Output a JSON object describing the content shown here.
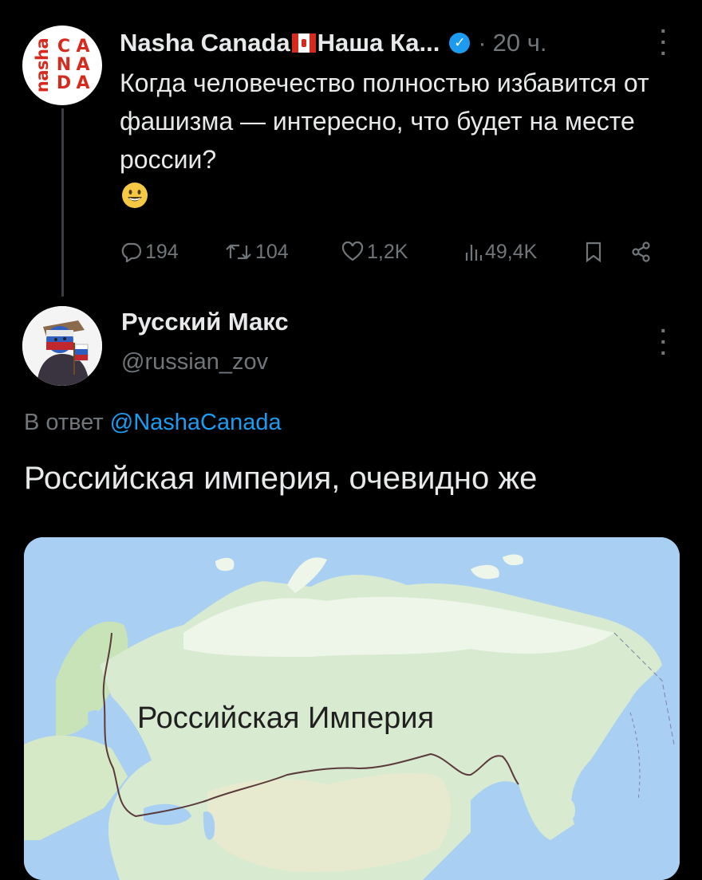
{
  "tweet1": {
    "avatar": {
      "side_text": "nasha",
      "letters": [
        "C",
        "A",
        "N",
        "A",
        "D",
        "A"
      ]
    },
    "author_name": "Nasha Canada",
    "author_name_suffix": "Наша Ка...",
    "verified_icon": "verified-badge-icon",
    "separator": "·",
    "time": "20 ч.",
    "text": "Когда человечество полностью избавится от фашизма — интересно, что будет на месте россии?",
    "emoji": "smiling-face-emoji",
    "stats": {
      "replies": "194",
      "reposts": "104",
      "likes": "1,2K",
      "views": "49,4K"
    }
  },
  "tweet2": {
    "author_name": "Русский Макс",
    "handle": "@russian_zov",
    "reply_prefix": "В ответ",
    "reply_handle": "@NashaCanada",
    "text": "Российская империя, очевидно же",
    "map_label": "Российская Империя"
  },
  "colors": {
    "background": "#000000",
    "text": "#e7e9ea",
    "secondary": "#71767b",
    "link": "#1d9bf0",
    "brand_red": "#d52b1e"
  }
}
